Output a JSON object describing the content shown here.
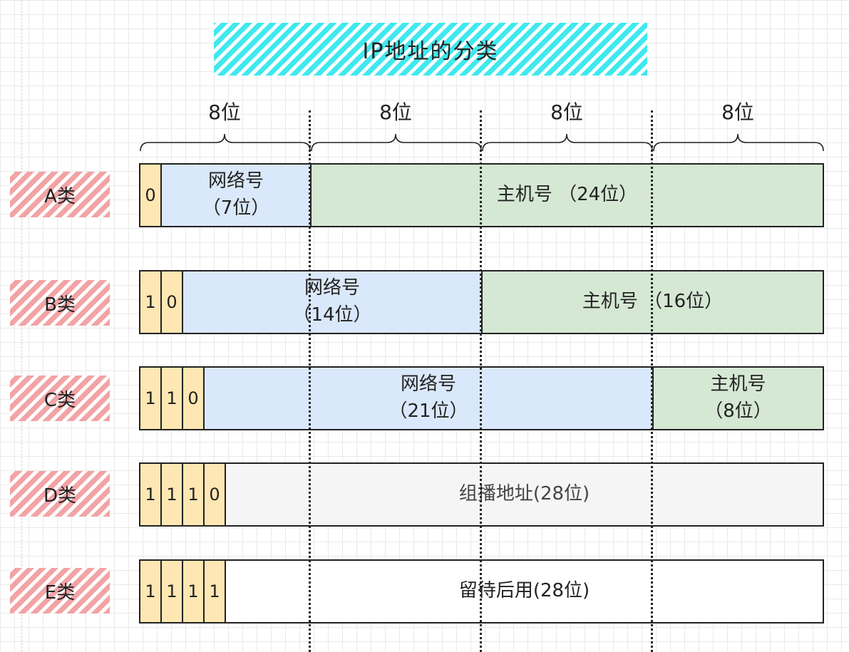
{
  "title": "IP地址的分类",
  "bit_groups": [
    "8位",
    "8位",
    "8位",
    "8位"
  ],
  "classes": [
    {
      "label": "A类",
      "bits": [
        "0"
      ],
      "network": {
        "name": "网络号",
        "bits": "（7位）"
      },
      "host": {
        "name": "主机号",
        "bits": "（24位）"
      }
    },
    {
      "label": "B类",
      "bits": [
        "1",
        "0"
      ],
      "network": {
        "name": "网络号",
        "bits": "（14位）"
      },
      "host": {
        "name": "主机号",
        "bits": "（16位）"
      }
    },
    {
      "label": "C类",
      "bits": [
        "1",
        "1",
        "0"
      ],
      "network": {
        "name": "网络号",
        "bits": "（21位）"
      },
      "host": {
        "name": "主机号",
        "bits": "（8位）"
      }
    },
    {
      "label": "D类",
      "bits": [
        "1",
        "1",
        "1",
        "0"
      ],
      "rest": "组播地址(28位)"
    },
    {
      "label": "E类",
      "bits": [
        "1",
        "1",
        "1",
        "1"
      ],
      "rest": "留待后用(28位)"
    }
  ],
  "colors": {
    "title_hatch": "#3fe9ee",
    "label_hatch": "#f2a3a5",
    "bit_fill": "#ffe7b3",
    "network_fill": "#dae8fb",
    "host_fill": "#d5e8d4",
    "multicast_fill": "#f5f5f5"
  }
}
